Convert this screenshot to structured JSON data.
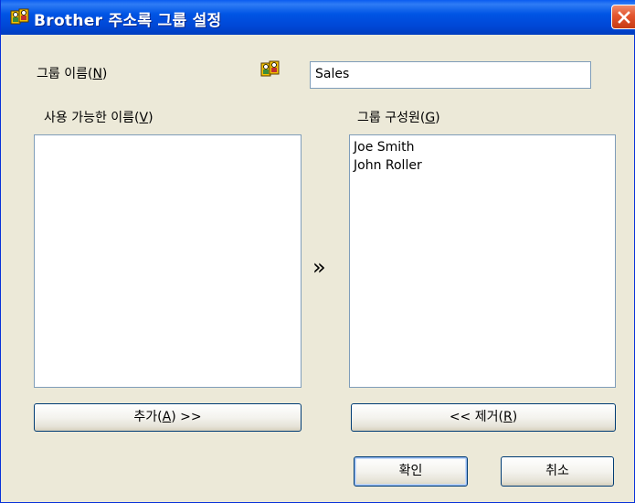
{
  "window": {
    "title": "Brother 주소록 그룹 설정"
  },
  "form": {
    "group_name_label_prefix": "그룹 이름(",
    "group_name_label_key": "N",
    "group_name_label_suffix": ")",
    "group_name_value": "Sales",
    "available_label_prefix": "사용 가능한 이름(",
    "available_label_key": "V",
    "available_label_suffix": ")",
    "members_label_prefix": "그룹 구성원(",
    "members_label_key": "G",
    "members_label_suffix": ")"
  },
  "available_names": [],
  "group_members": [
    "Joe Smith",
    "John Roller"
  ],
  "transfer_glyph": "»",
  "buttons": {
    "add_prefix": "추가(",
    "add_key": "A",
    "add_suffix": ") >>",
    "remove_prefix": "<< 제거(",
    "remove_key": "R",
    "remove_suffix": ")",
    "ok": "확인",
    "cancel": "취소"
  },
  "icons": {
    "title": "address-book-group-icon",
    "group": "address-book-group-icon",
    "close": "close-icon"
  },
  "colors": {
    "titlebar": "#0055e5",
    "dialog_bg": "#ece9d8",
    "close_button": "#e2542d",
    "field_border": "#7f9db9"
  }
}
